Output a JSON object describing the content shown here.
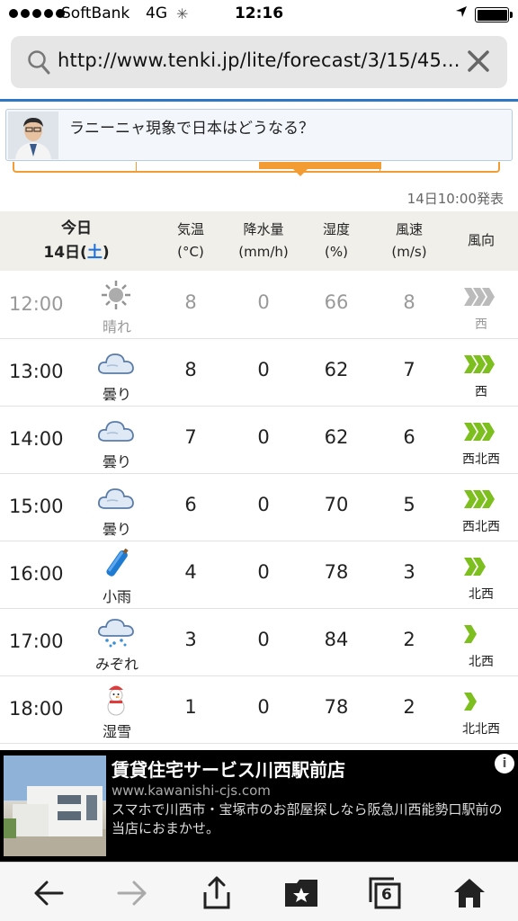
{
  "status_bar": {
    "carrier": "SoftBank",
    "network": "4G",
    "time": "12:16",
    "location_icon": "location-arrow-icon",
    "battery_icon": "battery-icon"
  },
  "browser": {
    "url": "http://www.tenki.jp/lite/forecast/3/15/45...",
    "search_icon": "search-icon",
    "clear_icon": "close-icon"
  },
  "banner": {
    "text": "ラニーニャ現象で日本はどうなる？"
  },
  "forecast": {
    "published": "14日10:00発表",
    "header": {
      "today": "今日",
      "date_prefix": "14日(",
      "weekday": "土",
      "date_suffix": ")",
      "temp": "気温",
      "temp_unit": "(°C)",
      "rain": "降水量",
      "rain_unit": "(mm/h)",
      "humidity": "湿度",
      "humidity_unit": "(%)",
      "wind": "風速",
      "wind_unit": "(m/s)",
      "direction": "風向"
    },
    "rows": [
      {
        "time": "12:00",
        "weather": "晴れ",
        "icon": "sun-icon",
        "temp": "8",
        "rain": "0",
        "humidity": "66",
        "wind": "8",
        "direction": "西",
        "past": true
      },
      {
        "time": "13:00",
        "weather": "曇り",
        "icon": "cloud-icon",
        "temp": "8",
        "rain": "0",
        "humidity": "62",
        "wind": "7",
        "direction": "西"
      },
      {
        "time": "14:00",
        "weather": "曇り",
        "icon": "cloud-icon",
        "temp": "7",
        "rain": "0",
        "humidity": "62",
        "wind": "6",
        "direction": "西北西"
      },
      {
        "time": "15:00",
        "weather": "曇り",
        "icon": "cloud-icon",
        "temp": "6",
        "rain": "0",
        "humidity": "70",
        "wind": "5",
        "direction": "西北西"
      },
      {
        "time": "16:00",
        "weather": "小雨",
        "icon": "umbrella-icon",
        "temp": "4",
        "rain": "0",
        "humidity": "78",
        "wind": "3",
        "direction": "北西"
      },
      {
        "time": "17:00",
        "weather": "みぞれ",
        "icon": "sleet-icon",
        "temp": "3",
        "rain": "0",
        "humidity": "84",
        "wind": "2",
        "direction": "北西"
      },
      {
        "time": "18:00",
        "weather": "湿雪",
        "icon": "snowman-icon",
        "temp": "1",
        "rain": "0",
        "humidity": "78",
        "wind": "2",
        "direction": "北北西"
      }
    ]
  },
  "ad": {
    "title": "賃貸住宅サービス川西駅前店",
    "url": "www.kawanishi-cjs.com",
    "description": "スマホで川西市・宝塚市のお部屋探しなら阪急川西能勢口駅前の当店におまかせ。",
    "info_icon": "info-icon"
  },
  "toolbar": {
    "tab_count": "6",
    "back_icon": "back-arrow-icon",
    "forward_icon": "forward-arrow-icon",
    "share_icon": "share-icon",
    "bookmarks_icon": "bookmarks-icon",
    "tabs_icon": "tabs-icon",
    "home_icon": "home-icon"
  },
  "colors": {
    "accent_orange": "#f39c33",
    "link_blue": "#2d77c9",
    "wind_green": "#7cbf1e",
    "header_bg": "#f0efe9"
  }
}
